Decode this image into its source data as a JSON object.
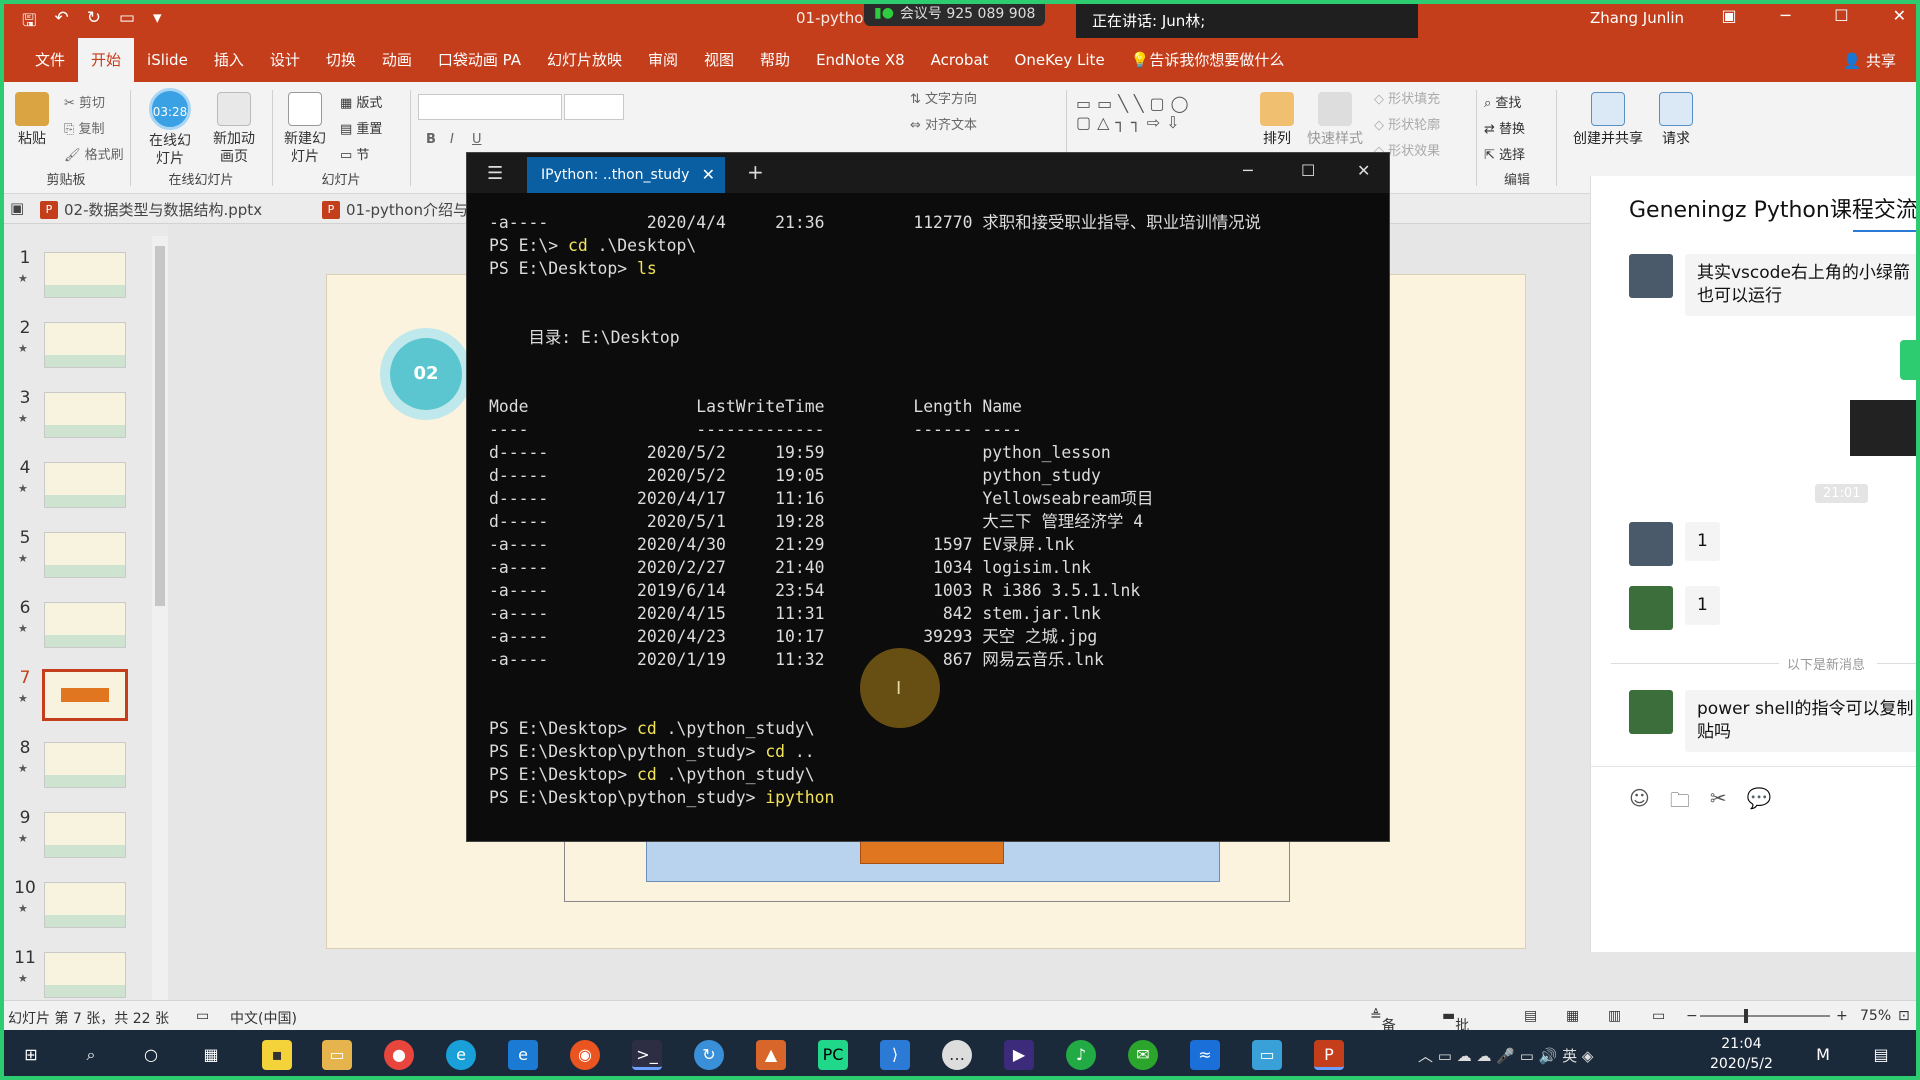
{
  "titlebar": {
    "doc_title": "01-python",
    "meeting_id": "会议号 925 089 908",
    "speaking": "正在讲话: Jun林;",
    "user": "Zhang Junlin"
  },
  "ribbon_tabs": [
    "文件",
    "开始",
    "iSlide",
    "插入",
    "设计",
    "切换",
    "动画",
    "口袋动画 PA",
    "幻灯片放映",
    "审阅",
    "视图",
    "帮助",
    "EndNote X8",
    "Acrobat",
    "OneKey Lite",
    "告诉我你想要做什么"
  ],
  "share_label": "共享",
  "ribbon": {
    "paste": "粘贴",
    "cut": "剪切",
    "copy": "复制",
    "format_painter": "格式刷",
    "clipboard": "剪贴板",
    "timer": "03:28",
    "online_slides": "在线幻灯片",
    "new_anim_page": "新加动画页",
    "online_group": "在线幻灯片",
    "new_slide": "新建幻灯片",
    "layout": "版式",
    "reset": "重置",
    "section": "节",
    "slides_group": "幻灯片",
    "text_direction": "文字方向",
    "align_text": "对齐文本",
    "arrange": "排列",
    "quick_styles": "快速样式",
    "shape_fill": "形状填充",
    "shape_outline": "形状轮廓",
    "shape_effects": "形状效果",
    "find": "查找",
    "replace": "替换",
    "select": "选择",
    "edit_group": "编辑",
    "create_share": "创建并共享",
    "request": "请求"
  },
  "doc_tabs": [
    "02-数据类型与数据结构.pptx",
    "01-python介绍与"
  ],
  "thumbnails": [
    "1",
    "2",
    "3",
    "4",
    "5",
    "6",
    "7",
    "8",
    "9",
    "10",
    "11"
  ],
  "slide": {
    "badge": "02"
  },
  "terminal": {
    "tab_title": "IPython: ..thon_study",
    "lines": [
      "-a----          2020/4/4     21:36         112770 求职和接受职业指导、职业培训情况说",
      "PS E:\\> cd .\\Desktop\\",
      "PS E:\\Desktop> ls",
      "",
      "",
      "    目录: E:\\Desktop",
      "",
      "",
      "Mode                 LastWriteTime         Length Name",
      "----                 -------------         ------ ----",
      "d-----          2020/5/2     19:59                python_lesson",
      "d-----          2020/5/2     19:05                python_study",
      "d-----         2020/4/17     11:16                Yellowseabream项目",
      "d-----          2020/5/1     19:28                大三下 管理经济学 4",
      "-a----         2020/4/30     21:29           1597 EV录屏.lnk",
      "-a----         2020/2/27     21:40           1034 logisim.lnk",
      "-a----         2019/6/14     23:54           1003 R i386 3.5.1.lnk",
      "-a----         2020/4/15     11:31            842 stem.jar.lnk",
      "-a----         2020/4/23     10:17          39293 天空 之城.jpg",
      "-a----         2020/1/19     11:32            867 网易云音乐.lnk",
      "",
      "",
      "PS E:\\Desktop> cd .\\python_study\\",
      "PS E:\\Desktop\\python_study> cd ..",
      "PS E:\\Desktop> cd .\\python_study\\",
      "PS E:\\Desktop\\python_study> ipython"
    ]
  },
  "chat": {
    "title": "Geneningz Python课程交流",
    "messages": [
      {
        "text": "其实vscode右上角的小绿箭\n也可以运行"
      },
      {
        "text": "1"
      },
      {
        "text": "1"
      },
      {
        "text": "power shell的指令可以复制\n贴吗"
      }
    ],
    "timestamp": "21:01",
    "new_messages": "以下是新消息"
  },
  "status": {
    "slide_info": "幻灯片 第 7 张，共 22 张",
    "language": "中文(中国)",
    "notes": "备注",
    "comments": "批注",
    "zoom": "75%"
  },
  "taskbar": {
    "time": "21:04",
    "date": "2020/5/2",
    "ime": "英"
  },
  "colors": {
    "accent": "#c43e1c",
    "terminal_bg": "#0c0c0c",
    "terminal_tab": "#0a5fa3",
    "prompt_cmd": "#f2e35a"
  }
}
